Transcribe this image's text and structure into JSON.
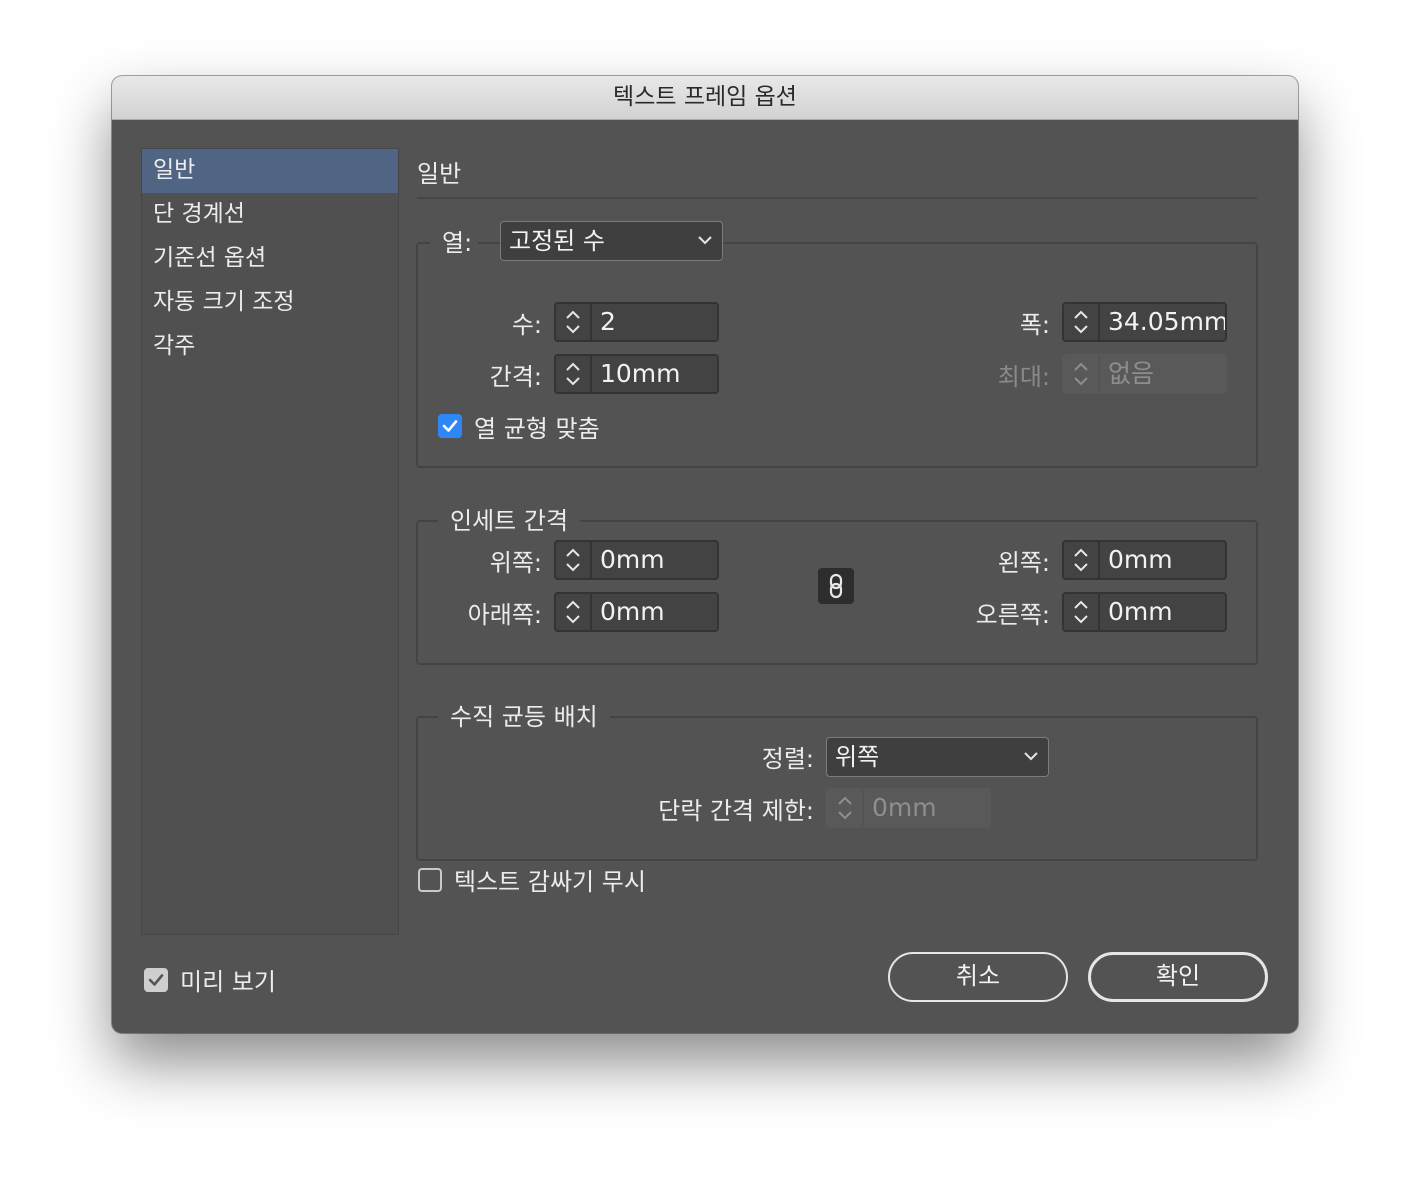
{
  "window": {
    "title": "텍스트 프레임 옵션"
  },
  "sidebar": {
    "items": [
      {
        "label": "일반"
      },
      {
        "label": "단 경계선"
      },
      {
        "label": "기준선 옵션"
      },
      {
        "label": "자동 크기 조정"
      },
      {
        "label": "각주"
      }
    ],
    "selected": "일반"
  },
  "main": {
    "heading": "일반",
    "columns": {
      "type_label": "열:",
      "type_value": "고정된 수",
      "number_label": "수:",
      "number_value": "2",
      "gutter_label": "간격:",
      "gutter_value": "10mm",
      "width_label": "폭:",
      "width_value": "34.05mm",
      "max_label": "최대:",
      "max_value": "없음",
      "balance_label": "열 균형 맞춤",
      "balance_checked": true
    },
    "inset": {
      "title": "인세트 간격",
      "top_label": "위쪽:",
      "top_value": "0mm",
      "bottom_label": "아래쪽:",
      "bottom_value": "0mm",
      "left_label": "왼쪽:",
      "left_value": "0mm",
      "right_label": "오른쪽:",
      "right_value": "0mm"
    },
    "vertical": {
      "title": "수직 균등 배치",
      "align_label": "정렬:",
      "align_value": "위쪽",
      "para_spacing_label": "단락 간격 제한:",
      "para_spacing_value": "0mm"
    },
    "ignore_wrap_label": "텍스트 감싸기 무시",
    "ignore_wrap_checked": false
  },
  "footer": {
    "preview_label": "미리 보기",
    "preview_checked": true,
    "cancel_label": "취소",
    "ok_label": "확인"
  },
  "colors": {
    "dialog_bg": "#535353",
    "selection": "#4f6583",
    "checkbox_accent": "#2f87f7"
  }
}
